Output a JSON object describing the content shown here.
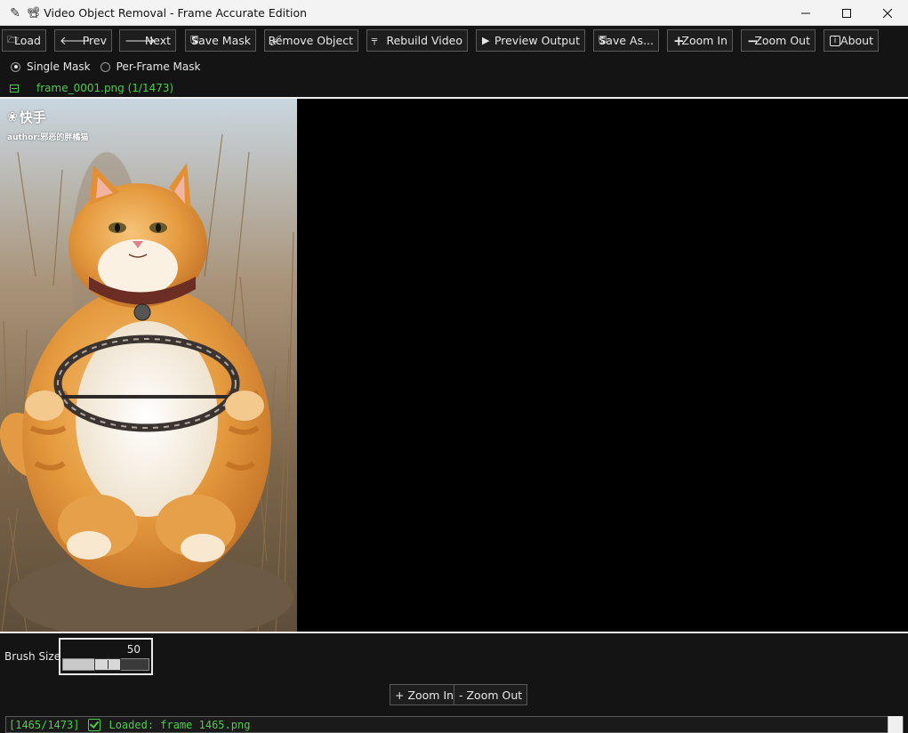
{
  "window": {
    "title": "Video Object Removal - Frame Accurate Edition",
    "title_icon": "film-projector-icon",
    "controls": [
      "minimize",
      "maximize",
      "close"
    ]
  },
  "toolbar": {
    "load": {
      "label": "Load",
      "icon": "folder-icon"
    },
    "prev": {
      "label": "Prev",
      "icon": "arrow-left-icon"
    },
    "next": {
      "label": "Next",
      "icon": "arrow-right-icon"
    },
    "save_mask": {
      "label": "Save Mask",
      "icon": "disk-icon"
    },
    "remove_object": {
      "label": "Remove Object",
      "icon": "brush-icon"
    },
    "rebuild_video": {
      "label": "Rebuild Video",
      "icon": "hammer-icon"
    },
    "preview_output": {
      "label": "Preview Output",
      "icon": "play-icon"
    },
    "save_as": {
      "label": "Save As...",
      "icon": "disk-icon"
    },
    "zoom_in": {
      "label": "Zoom In",
      "icon": "plus-icon"
    },
    "zoom_out": {
      "label": "Zoom Out",
      "icon": "minus-icon"
    },
    "about": {
      "label": "About",
      "icon": "info-icon"
    }
  },
  "mask_mode": {
    "options": [
      "Single Mask",
      "Per-Frame Mask"
    ],
    "selected": "Single Mask"
  },
  "frame_info": {
    "label": "frame_0001.png (1/1473)",
    "color": "#4ecb4e"
  },
  "canvas": {
    "watermark_brand": "快手",
    "watermark_author": "author:邪恶的胖橘猫",
    "image_description_icon": "cat-frame-image"
  },
  "brush": {
    "label": "Brush Size",
    "value": 50,
    "value_text": "50",
    "min": 1,
    "max": 100
  },
  "zoom_controls": {
    "zoom_in": "+ Zoom In",
    "zoom_out": "- Zoom Out"
  },
  "status": {
    "text_prefix": "[1465/1473]",
    "text_message": "Loaded: frame 1465.png",
    "color": "#4ecb4e"
  },
  "colors": {
    "background": "#141414",
    "accent_green": "#4ecb4e",
    "button_border": "#5a5a5a"
  }
}
